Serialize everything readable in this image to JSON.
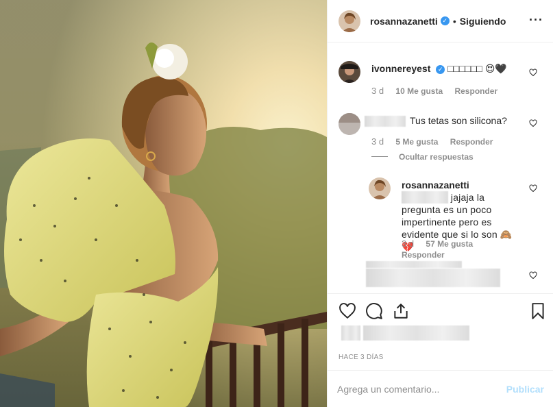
{
  "photo": {
    "description_icon": "post-photo"
  },
  "header": {
    "username": "rosannazanetti",
    "separator": "•",
    "follow_state": "Siguiendo",
    "more": "···"
  },
  "comments": [
    {
      "username": "ivonnereyest",
      "text": "□□□□□□ 😍🖤",
      "time": "3 d",
      "likes": "10 Me gusta",
      "reply": "Responder"
    },
    {
      "text": "Tus tetas son silicona?",
      "time": "3 d",
      "likes": "5 Me gusta",
      "reply": "Responder",
      "hide_replies": "Ocultar respuestas"
    },
    {
      "username": "rosannazanetti",
      "text": "jajaja la pregunta es un poco impertinente pero es evidente que si lo son 🙈💔",
      "time": "3 d",
      "likes": "57 Me gusta",
      "reply": "Responder"
    }
  ],
  "footer": {
    "time_ago": "HACE 3 DÍAS",
    "comment_placeholder": "Agrega un comentario...",
    "publish": "Publicar"
  },
  "icons": [
    "like-icon",
    "comment-icon",
    "share-icon",
    "save-icon",
    "verified-icon"
  ],
  "colors": {
    "verified": "#3897f0",
    "publish_disabled": "#b2dffc",
    "meta": "#8e8e8e"
  }
}
